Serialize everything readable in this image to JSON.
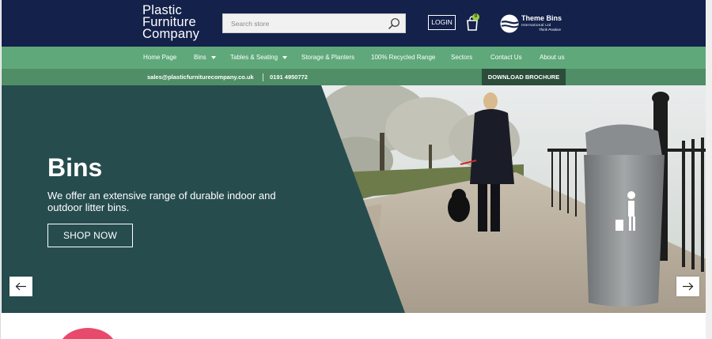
{
  "header": {
    "logo_lines": [
      "Plastic",
      "Furniture",
      "Company"
    ],
    "search_placeholder": "Search store",
    "login_label": "LOGIN",
    "cart_count": "0",
    "partner_logo": {
      "name": "Theme Bins",
      "sub": "International Ltd",
      "tag": "Think Positive"
    }
  },
  "nav": {
    "items": [
      {
        "label": "Home Page",
        "dropdown": false
      },
      {
        "label": "Bins",
        "dropdown": true
      },
      {
        "label": "Tables & Seating",
        "dropdown": true
      },
      {
        "label": "Storage & Planters",
        "dropdown": false
      },
      {
        "label": "100% Recycled Range",
        "dropdown": false
      },
      {
        "label": "Sectors",
        "dropdown": false
      },
      {
        "label": "Contact Us",
        "dropdown": false
      },
      {
        "label": "About us",
        "dropdown": false
      }
    ]
  },
  "contact": {
    "email": "sales@plasticfurniturecompany.co.uk",
    "phone": "0191 4950772",
    "brochure_label": "DOWNLOAD BROCHURE"
  },
  "hero": {
    "title": "Bins",
    "text": "We offer an extensive range of durable indoor and outdoor litter bins.",
    "cta_label": "SHOP NOW",
    "prev_icon": "arrow-left-icon",
    "next_icon": "arrow-right-icon"
  },
  "colors": {
    "header_bg": "#14214a",
    "nav_bg": "#5fa87a",
    "contact_bg": "#4f8e66",
    "brochure_bg": "#2c4d3a",
    "hero_panel": "#264c4e",
    "cart_badge": "#9bcf3a",
    "accent_pink": "#e84a6c"
  }
}
